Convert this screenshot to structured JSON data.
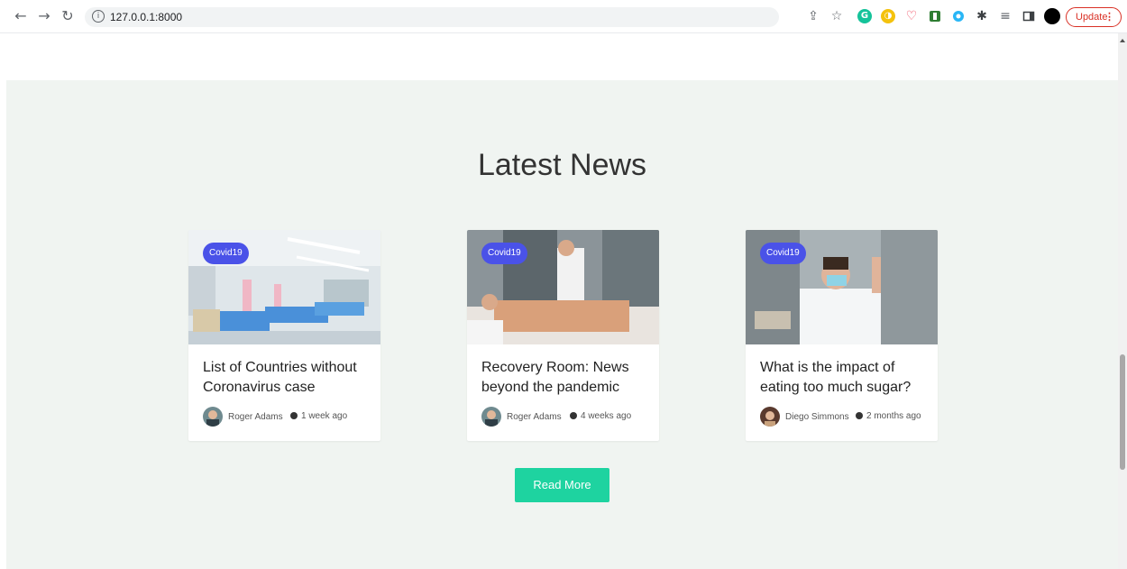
{
  "browser": {
    "url": "127.0.0.1:8000",
    "update_label": "Update",
    "update_menu_glyph": "⋮",
    "icons": [
      "back-icon",
      "forward-icon",
      "reload-icon",
      "site-info-icon",
      "share-icon",
      "bookmark-star-icon",
      "extension-grammarly-icon",
      "extension-yellow-icon",
      "pocket-icon",
      "extension-green-icon",
      "extension-blue-icon",
      "extensions-puzzle-icon",
      "reading-list-icon",
      "side-panel-icon",
      "profile-avatar"
    ],
    "colors": {
      "update_border": "#d93025"
    }
  },
  "section": {
    "title": "Latest News",
    "background": "#f0f4f1"
  },
  "cards": [
    {
      "badge": "Covid19",
      "title": "List of Countries without Coronavirus case",
      "author": "Roger Adams",
      "time": "1 week ago",
      "image": "hospital-ward-photo"
    },
    {
      "badge": "Covid19",
      "title": "Recovery Room: News beyond the pandemic",
      "author": "Roger Adams",
      "time": "4 weeks ago",
      "image": "doctor-patient-photo"
    },
    {
      "badge": "Covid19",
      "title": "What is the impact of eating too much sugar?",
      "author": "Diego Simmons",
      "time": "2 months ago",
      "image": "masked-doctor-photo"
    }
  ],
  "read_more": "Read More",
  "colors": {
    "badge": "#4a52e8",
    "button": "#1ed3a0"
  }
}
